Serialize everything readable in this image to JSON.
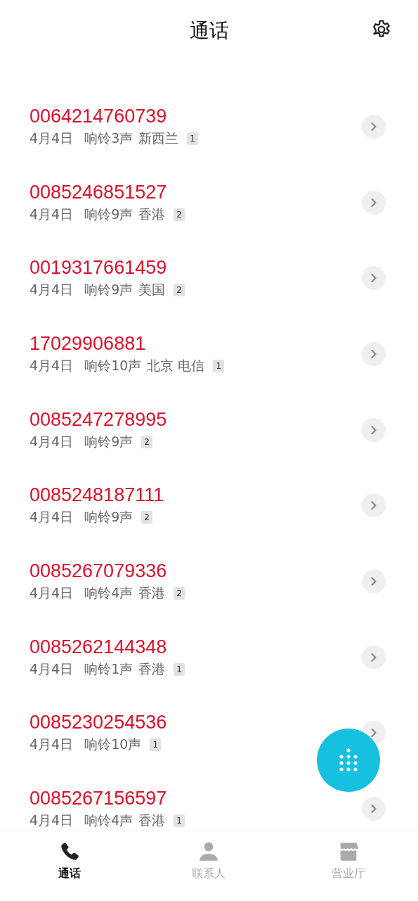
{
  "header": {
    "title": "通话"
  },
  "calls": [
    {
      "number": "0064214760739",
      "date": "4月4日",
      "rings": "响铃3声",
      "location": "新西兰",
      "count": "1"
    },
    {
      "number": "0085246851527",
      "date": "4月4日",
      "rings": "响铃9声",
      "location": "香港",
      "count": "2"
    },
    {
      "number": "0019317661459",
      "date": "4月4日",
      "rings": "响铃9声",
      "location": "美国",
      "count": "2"
    },
    {
      "number": "17029906881",
      "date": "4月4日",
      "rings": "响铃10声",
      "location": "北京 电信",
      "count": "1"
    },
    {
      "number": "0085247278995",
      "date": "4月4日",
      "rings": "响铃9声",
      "count": "2"
    },
    {
      "number": "0085248187111",
      "date": "4月4日",
      "rings": "响铃9声",
      "count": "2"
    },
    {
      "number": "0085267079336",
      "date": "4月4日",
      "rings": "响铃4声",
      "location": "香港",
      "count": "2"
    },
    {
      "number": "0085262144348",
      "date": "4月4日",
      "rings": "响铃1声",
      "location": "香港",
      "count": "1"
    },
    {
      "number": "0085230254536",
      "date": "4月4日",
      "rings": "响铃10声",
      "count": "1"
    },
    {
      "number": "0085267156597",
      "date": "4月4日",
      "rings": "响铃4声",
      "location": "香港",
      "count": "1"
    }
  ],
  "tabs": [
    {
      "kind": "phone",
      "label": "通话",
      "selected": true
    },
    {
      "kind": "contacts",
      "label": "联系人",
      "selected": false
    },
    {
      "kind": "store",
      "label": "营业厅",
      "selected": false
    }
  ]
}
